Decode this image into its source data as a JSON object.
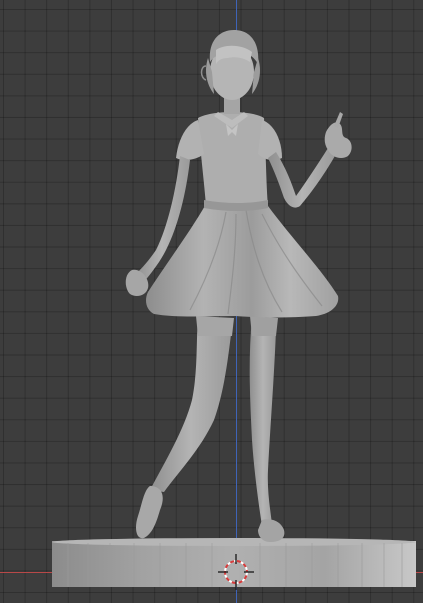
{
  "viewport": {
    "editor": "3D Viewport",
    "background_color": "#3d3d3d",
    "grid_line_color": "#2f2f2f",
    "axis_y_color": "#3f64b8",
    "axis_x_color": "#b84848"
  },
  "scene": {
    "object": "figurine-model",
    "material_color": "#a9a9a9",
    "base": "cylindrical-pedestal",
    "cursor": "3d-cursor-icon"
  }
}
